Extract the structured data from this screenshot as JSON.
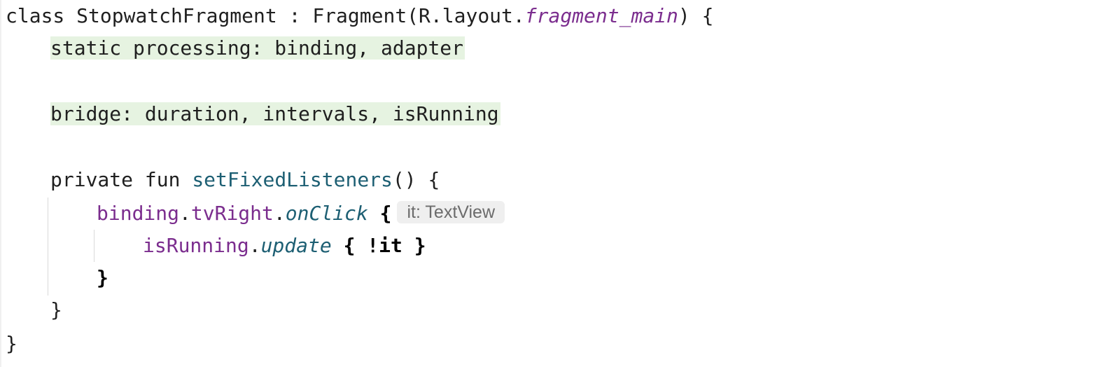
{
  "code": {
    "line1": {
      "kw_class": "class",
      "class_name": "StopwatchFragment",
      "colon": ":",
      "super_call": "Fragment(R.layout.",
      "layout_ref": "fragment_main",
      "close": ") {"
    },
    "line2": {
      "text": "static processing: binding, adapter"
    },
    "line3": {
      "text": "bridge: duration, intervals, isRunning"
    },
    "line4": {
      "kw_private": "private",
      "kw_fun": "fun",
      "fn_name": "setFixedListeners",
      "rest": "() {"
    },
    "line5": {
      "binding": "binding",
      "dot1": ".",
      "tvRight": "tvRight",
      "dot2": ".",
      "onClick": "onClick",
      "brace": "{",
      "hint": "it: TextView"
    },
    "line6": {
      "isRunning": "isRunning",
      "dot": ".",
      "update": "update",
      "lambda": "{ !it }"
    },
    "line7": {
      "text": "}"
    },
    "line8": {
      "text": "}"
    },
    "line9": {
      "text": "}"
    }
  },
  "colors": {
    "keyword_purple": "#7b2d8e",
    "function_teal": "#1d5f73",
    "highlight_green": "#e6f3e1",
    "hint_bg": "#efefef"
  }
}
